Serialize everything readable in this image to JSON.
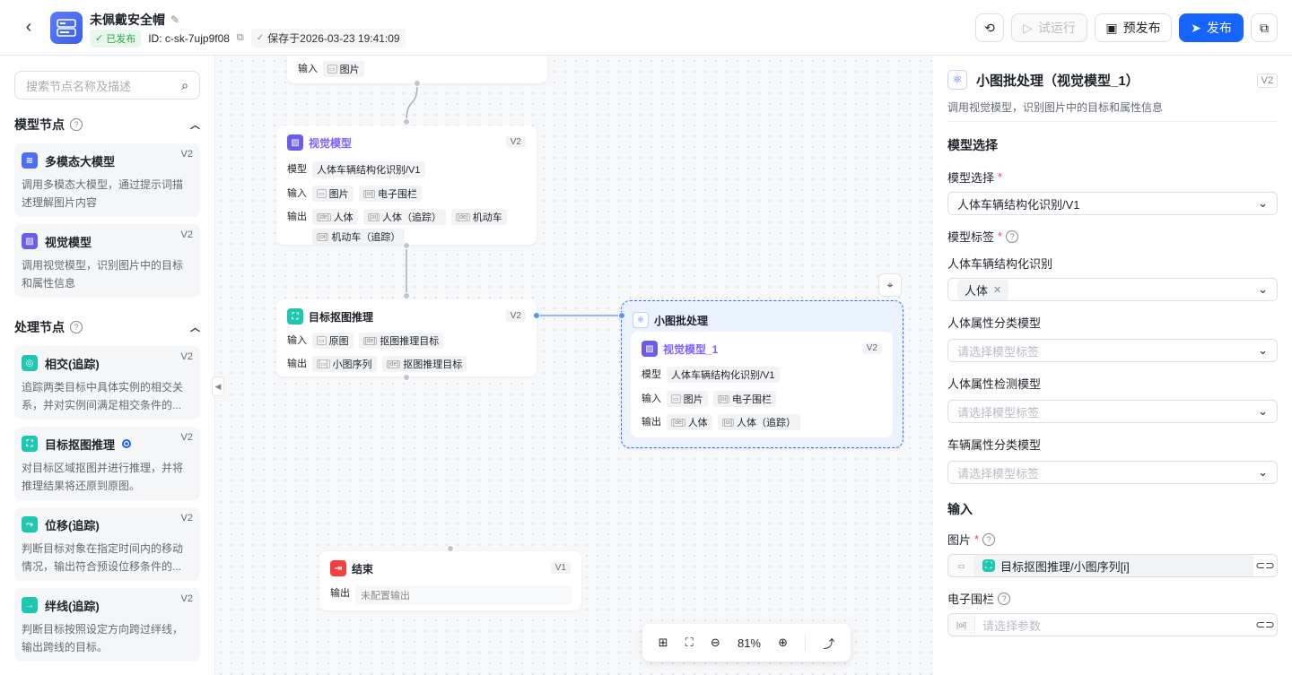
{
  "header": {
    "title": "未佩戴安全帽",
    "status": "已发布",
    "id_text": "ID: c-sk-7ujp9f08",
    "saved_text": "保存于2026-03-23 19:41:09",
    "run_label": "试运行",
    "prepublish_label": "预发布",
    "publish_label": "发布"
  },
  "sidebar": {
    "search_placeholder": "搜索节点名称及描述",
    "model_section": "模型节点",
    "process_section": "处理节点",
    "model_nodes": [
      {
        "title": "多模态大模型",
        "version": "V2",
        "desc": "调用多模态大模型，通过提示词描述理解图片内容",
        "color": "#4e6ef2"
      },
      {
        "title": "视觉模型",
        "version": "V2",
        "desc": "调用视觉模型，识别图片中的目标和属性信息",
        "color": "#6c5ce7"
      }
    ],
    "process_nodes": [
      {
        "title": "相交(追踪)",
        "version": "V2",
        "desc": "追踪两类目标中具体实例的相交关系，并对实例间满足相交条件的...",
        "color": "#1fc6b0"
      },
      {
        "title": "目标抠图推理",
        "version": "V2",
        "desc": "对目标区域抠图并进行推理，并将推理结果将还原到原图。",
        "color": "#1fc6b0"
      },
      {
        "title": "位移(追踪)",
        "version": "V2",
        "desc": "判断目标对象在指定时间内的移动情况，输出符合预设位移条件的...",
        "color": "#1fc6b0"
      },
      {
        "title": "绊线(追踪)",
        "version": "V2",
        "desc": "判断目标按照设定方向跨过绊线，输出跨线的目标。",
        "color": "#1fc6b0"
      }
    ]
  },
  "canvas": {
    "top_node": {
      "input_label": "输入",
      "input_tag": "图片"
    },
    "vision_node": {
      "title": "视觉模型",
      "version": "V2",
      "model_label": "模型",
      "model": "人体车辆结构化识别/V1",
      "input_label": "输入",
      "inputs": [
        "图片",
        "电子围栏"
      ],
      "output_label": "输出",
      "outputs": [
        "人体",
        "人体（追踪）",
        "机动车",
        "机动车（追踪）"
      ]
    },
    "crop_node": {
      "title": "目标抠图推理",
      "version": "V2",
      "input_label": "输入",
      "inputs": [
        "原图",
        "抠图推理目标"
      ],
      "output_label": "输出",
      "outputs": [
        "小图序列",
        "抠图推理目标"
      ]
    },
    "batch_node": {
      "title": "小图批处理",
      "inner_title": "视觉模型_1",
      "inner_version": "V2",
      "model_label": "模型",
      "model": "人体车辆结构化识别/V1",
      "input_label": "输入",
      "inputs": [
        "图片",
        "电子围栏"
      ],
      "output_label": "输出",
      "outputs": [
        "人体",
        "人体（追踪）"
      ]
    },
    "end_node": {
      "title": "结束",
      "version": "V1",
      "output_label": "输出",
      "output": "未配置输出"
    },
    "zoom": "81%"
  },
  "panel": {
    "title": "小图批处理（视觉模型_1）",
    "version": "V2",
    "desc": "调用视觉模型，识别图片中的目标和属性信息",
    "model_section": "模型选择",
    "model_select_label": "模型选择",
    "model_value": "人体车辆结构化识别/V1",
    "model_tag_label": "模型标签",
    "sub1_label": "人体车辆结构化识别",
    "sub1_chip": "人体",
    "sub2_label": "人体属性分类模型",
    "sub2_ph": "请选择模型标签",
    "sub3_label": "人体属性检测模型",
    "sub3_ph": "请选择模型标签",
    "sub4_label": "车辆属性分类模型",
    "sub4_ph": "请选择模型标签",
    "input_section": "输入",
    "img_label": "图片",
    "img_value": "目标抠图推理/小图序列[i]",
    "fence_label": "电子围栏",
    "fence_ph": "请选择参数"
  }
}
